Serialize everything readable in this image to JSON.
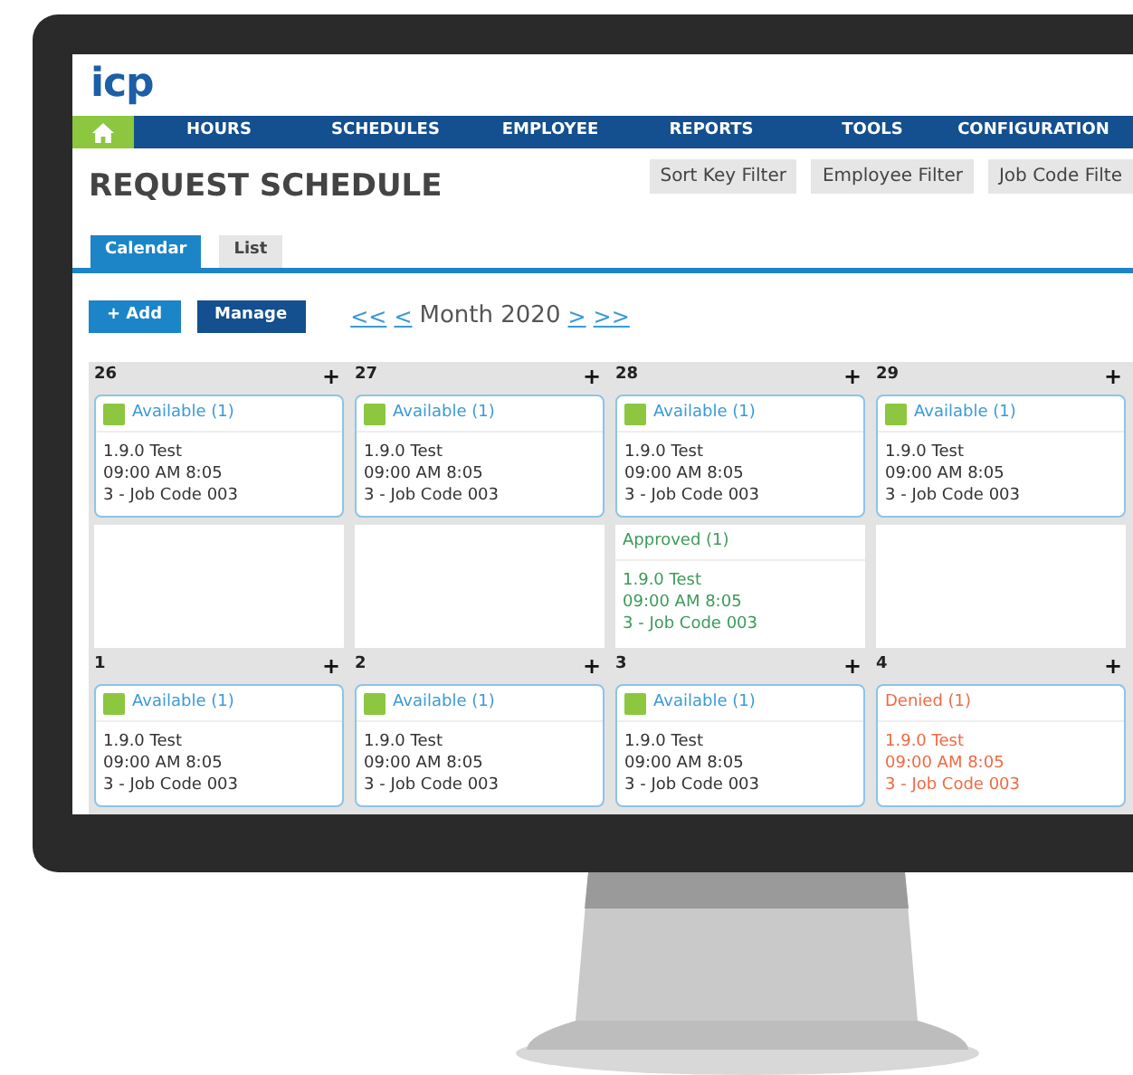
{
  "app": {
    "logo": "icp"
  },
  "nav": {
    "items": [
      {
        "label": "HOURS"
      },
      {
        "label": "SCHEDULES"
      },
      {
        "label": "EMPLOYEE"
      },
      {
        "label": "REPORTS"
      },
      {
        "label": "TOOLS"
      },
      {
        "label": "CONFIGURATION"
      }
    ]
  },
  "page": {
    "title": "REQUEST SCHEDULE",
    "filters": [
      "Sort Key Filter",
      "Employee Filter",
      "Job Code Filte"
    ]
  },
  "tabs": [
    {
      "label": "Calendar",
      "selected": true
    },
    {
      "label": "List",
      "selected": false
    }
  ],
  "toolbar": {
    "add": "+ Add",
    "manage": "Manage",
    "first": "<<",
    "prev": "<",
    "period": "Month 2020",
    "next": ">",
    "last": ">>"
  },
  "calendar": {
    "add_symbol": "+",
    "weeks": [
      {
        "dates": [
          "26",
          "27",
          "28",
          "29"
        ],
        "rows": [
          [
            {
              "entry": {
                "kind": "available",
                "label": "Available (1)",
                "lines": [
                  "1.9.0 Test",
                  "09:00 AM 8:05",
                  "3 - Job Code 003"
                ]
              }
            },
            {
              "entry": {
                "kind": "available",
                "label": "Available (1)",
                "lines": [
                  "1.9.0 Test",
                  "09:00 AM 8:05",
                  "3 - Job Code 003"
                ]
              }
            },
            {
              "entry": {
                "kind": "available",
                "label": "Available (1)",
                "lines": [
                  "1.9.0 Test",
                  "09:00 AM 8:05",
                  "3 - Job Code 003"
                ]
              }
            },
            {
              "entry": {
                "kind": "available",
                "label": "Available (1)",
                "lines": [
                  "1.9.0 Test",
                  "09:00 AM 8:05",
                  "3 - Job Code 003"
                ]
              }
            }
          ],
          [
            {},
            {},
            {
              "entry": {
                "kind": "approved",
                "label": "Approved (1)",
                "lines": [
                  "1.9.0 Test",
                  "09:00 AM 8:05",
                  "3 - Job Code 003"
                ]
              }
            },
            {}
          ]
        ]
      },
      {
        "dates": [
          "1",
          "2",
          "3",
          "4"
        ],
        "rows": [
          [
            {
              "entry": {
                "kind": "available",
                "label": "Available (1)",
                "lines": [
                  "1.9.0 Test",
                  "09:00 AM 8:05",
                  "3 - Job Code 003"
                ]
              }
            },
            {
              "entry": {
                "kind": "available",
                "label": "Available (1)",
                "lines": [
                  "1.9.0 Test",
                  "09:00 AM 8:05",
                  "3 - Job Code 003"
                ]
              }
            },
            {
              "entry": {
                "kind": "available",
                "label": "Available (1)",
                "lines": [
                  "1.9.0 Test",
                  "09:00 AM 8:05",
                  "3 - Job Code 003"
                ]
              }
            },
            {
              "entry": {
                "kind": "denied",
                "label": "Denied (1)",
                "lines": [
                  "1.9.0 Test",
                  "09:00 AM 8:05",
                  "3 - Job Code 003"
                ]
              }
            }
          ]
        ]
      }
    ]
  }
}
